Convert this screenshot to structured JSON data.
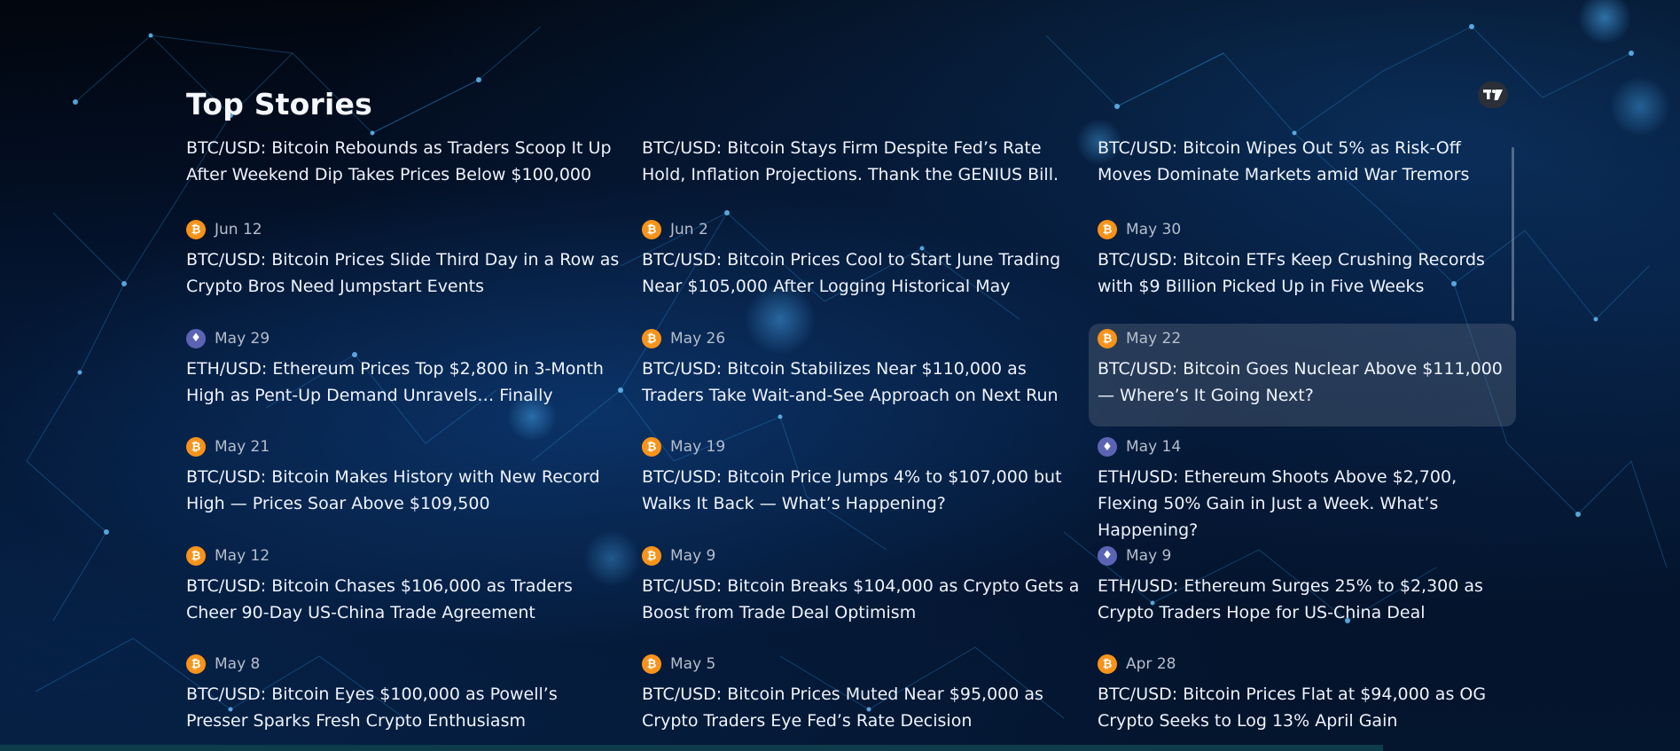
{
  "section_title": "Top Stories",
  "stories": [
    {
      "coin": "btc",
      "date": "",
      "headline": "BTC/USD: Bitcoin Rebounds as Traders Scoop It Up After Weekend Dip Takes Prices Below $100,000"
    },
    {
      "coin": "btc",
      "date": "",
      "headline": "BTC/USD: Bitcoin Stays Firm Despite Fed’s Rate Hold, Inflation Projections. Thank the GENIUS Bill."
    },
    {
      "coin": "btc",
      "date": "",
      "headline": "BTC/USD: Bitcoin Wipes Out 5% as Risk-Off Moves Dominate Markets amid War Tremors"
    },
    {
      "coin": "btc",
      "date": "Jun 12",
      "headline": "BTC/USD: Bitcoin Prices Slide Third Day in a Row as Crypto Bros Need Jumpstart Events"
    },
    {
      "coin": "btc",
      "date": "Jun 2",
      "headline": "BTC/USD: Bitcoin Prices Cool to Start June Trading Near $105,000 After Logging Historical May"
    },
    {
      "coin": "btc",
      "date": "May 30",
      "headline": "BTC/USD: Bitcoin ETFs Keep Crushing Records with $9 Billion Picked Up in Five Weeks"
    },
    {
      "coin": "eth",
      "date": "May 29",
      "headline": "ETH/USD: Ethereum Prices Top $2,800 in 3-Month High as Pent-Up Demand Unravels… Finally"
    },
    {
      "coin": "btc",
      "date": "May 26",
      "headline": "BTC/USD: Bitcoin Stabilizes Near $110,000 as Traders Take Wait-and-See Approach on Next Run"
    },
    {
      "coin": "btc",
      "date": "May 22",
      "headline": "BTC/USD: Bitcoin Goes Nuclear Above $111,000 — Where’s It Going Next?"
    },
    {
      "coin": "btc",
      "date": "May 21",
      "headline": "BTC/USD: Bitcoin Makes History with New Record High — Prices Soar Above $109,500"
    },
    {
      "coin": "btc",
      "date": "May 19",
      "headline": "BTC/USD: Bitcoin Price Jumps 4% to $107,000 but Walks It Back — What’s Happening?"
    },
    {
      "coin": "eth",
      "date": "May 14",
      "headline": "ETH/USD: Ethereum Shoots Above $2,700, Flexing 50% Gain in Just a Week. What’s Happening?"
    },
    {
      "coin": "btc",
      "date": "May 12",
      "headline": "BTC/USD: Bitcoin Chases $106,000 as Traders Cheer 90-Day US-China Trade Agreement"
    },
    {
      "coin": "btc",
      "date": "May 9",
      "headline": "BTC/USD: Bitcoin Breaks $104,000 as Crypto Gets a Boost from Trade Deal Optimism"
    },
    {
      "coin": "eth",
      "date": "May 9",
      "headline": "ETH/USD: Ethereum Surges 25% to $2,300 as Crypto Traders Hope for US-China Deal"
    },
    {
      "coin": "btc",
      "date": "May 8",
      "headline": "BTC/USD: Bitcoin Eyes $100,000 as Powell’s Presser Sparks Fresh Crypto Enthusiasm"
    },
    {
      "coin": "btc",
      "date": "May 5",
      "headline": "BTC/USD: Bitcoin Prices Muted Near $95,000 as Crypto Traders Eye Fed’s Rate Decision"
    },
    {
      "coin": "btc",
      "date": "Apr 28",
      "headline": "BTC/USD: Bitcoin Prices Flat at $94,000 as OG Crypto Seeks to Log 13% April Gain"
    }
  ],
  "highlighted_index": 8,
  "icons": {
    "bitcoin": "bitcoin-icon",
    "ethereum": "ethereum-icon",
    "brand": "tradingview-logo-icon"
  },
  "colors": {
    "bitcoin": "#f7931a",
    "ethereum": "#5b64b4",
    "background": "#020814"
  }
}
